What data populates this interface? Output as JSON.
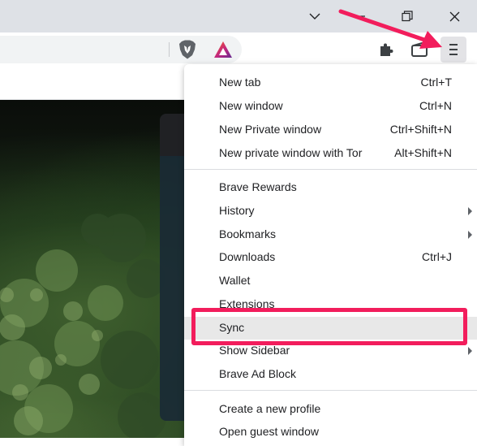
{
  "window_controls": {
    "tab_search": "chevron-down-icon",
    "minimize": "minimize-icon",
    "restore": "restore-icon",
    "close": "close-icon"
  },
  "toolbar": {
    "brave_shields_icon": "brave-lion-icon",
    "rewards_icon": "brave-rewards-triangle-icon",
    "extensions_icon": "puzzle-icon",
    "wallet_icon": "wallet-icon",
    "menu_icon": "hamburger-menu-icon"
  },
  "menu": {
    "groups": [
      {
        "items": [
          {
            "label": "New tab",
            "shortcut": "Ctrl+T"
          },
          {
            "label": "New window",
            "shortcut": "Ctrl+N"
          },
          {
            "label": "New Private window",
            "shortcut": "Ctrl+Shift+N"
          },
          {
            "label": "New private window with Tor",
            "shortcut": "Alt+Shift+N"
          }
        ]
      },
      {
        "items": [
          {
            "label": "Brave Rewards",
            "shortcut": ""
          },
          {
            "label": "History",
            "shortcut": "",
            "submenu": true
          },
          {
            "label": "Bookmarks",
            "shortcut": "",
            "submenu": true
          },
          {
            "label": "Downloads",
            "shortcut": "Ctrl+J"
          },
          {
            "label": "Wallet",
            "shortcut": ""
          },
          {
            "label": "Extensions",
            "shortcut": ""
          },
          {
            "label": "Sync",
            "shortcut": "",
            "highlighted": true
          },
          {
            "label": "Show Sidebar",
            "shortcut": "",
            "submenu": true
          },
          {
            "label": "Brave Ad Block",
            "shortcut": ""
          }
        ]
      },
      {
        "items": [
          {
            "label": "Create a new profile",
            "shortcut": ""
          },
          {
            "label": "Open guest window",
            "shortcut": ""
          }
        ]
      }
    ]
  },
  "annotation": {
    "color": "#f21d5c"
  }
}
